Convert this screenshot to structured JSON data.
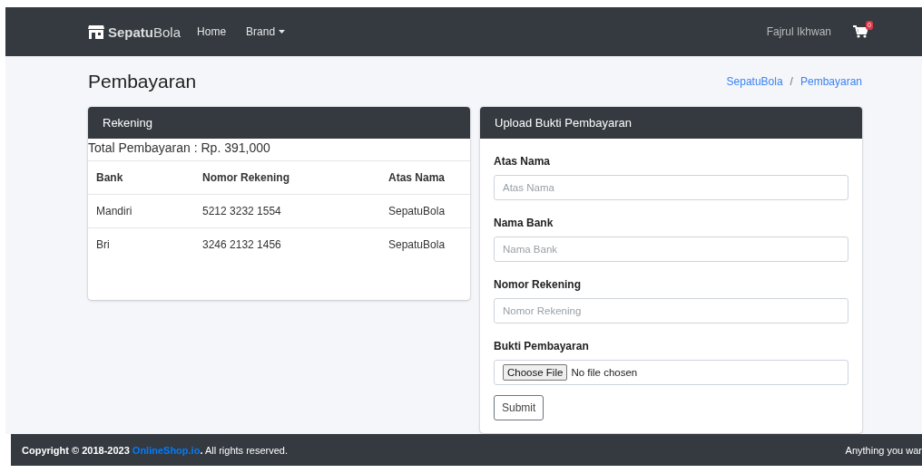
{
  "navbar": {
    "brand": "**Sepatu**Bola",
    "links": [
      {
        "label": "Home",
        "dropdown": false
      },
      {
        "label": "Brand",
        "dropdown": true
      }
    ],
    "user": "Fajrul Ikhwan",
    "cart_count": "0"
  },
  "page_title": "Pembayaran",
  "breadcrumb": [
    "SepatuBola",
    "/",
    "Pembayaran"
  ],
  "rekening": {
    "title": "Rekening",
    "total": "Total Pembayaran : Rp. 391,000",
    "columns": [
      "Bank",
      "Nomor Rekening",
      "Atas Nama"
    ],
    "rows": [
      [
        "Mandiri",
        "5212 3232 1554",
        "SepatuBola"
      ],
      [
        "Bri",
        "3246 2132 1456",
        "SepatuBola"
      ]
    ]
  },
  "upload": {
    "title": "Upload Bukti Pembayaran",
    "fields": [
      {
        "kind": "text",
        "label": "Atas Nama",
        "placeholder": "Atas Nama"
      },
      {
        "kind": "text",
        "label": "Nama Bank",
        "placeholder": "Nama Bank"
      },
      {
        "kind": "text",
        "label": "Nomor Rekening",
        "placeholder": "Nomor Rekening"
      },
      {
        "kind": "file",
        "label": "Bukti Pembayaran",
        "button": "Choose File",
        "status": "No file chosen"
      }
    ],
    "submit": "Submit"
  },
  "footer": {
    "copyright": "Copyright © 2018-2023",
    "link": "OnlineShop.io",
    "suffix_bold": ".",
    "suffix": " All rights reserved.",
    "right": "Anything you war"
  }
}
